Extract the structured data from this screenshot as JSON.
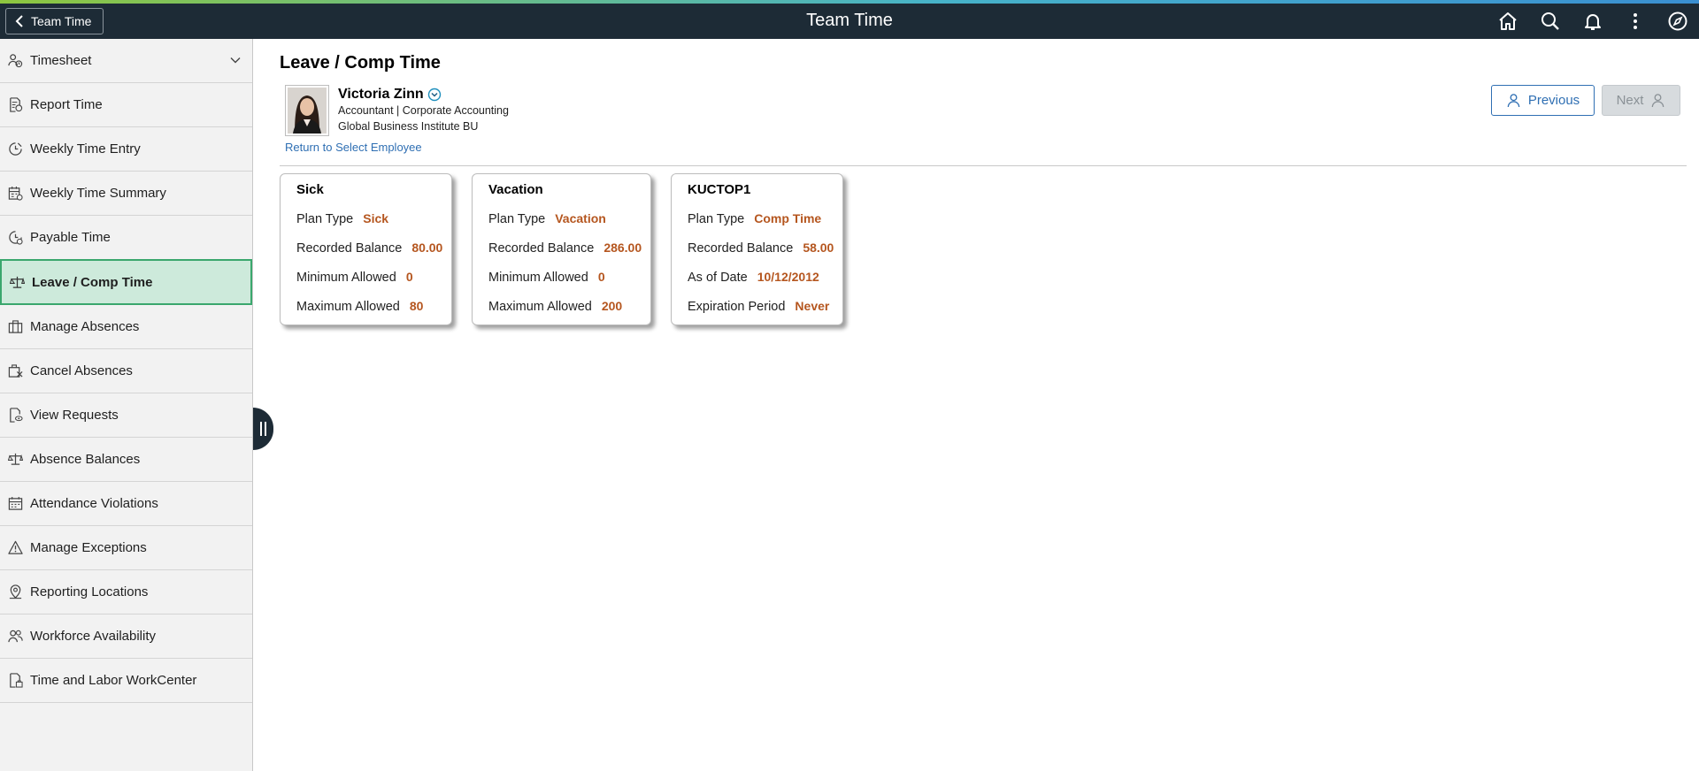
{
  "header": {
    "back_label": "Team Time",
    "title": "Team Time",
    "icons": [
      "home-icon",
      "search-icon",
      "notifications-icon",
      "actions-menu-icon",
      "navbar-icon"
    ]
  },
  "sidebar": {
    "items": [
      {
        "label": "Timesheet",
        "icon": "timesheet-icon",
        "expandable": true
      },
      {
        "label": "Report Time",
        "icon": "report-time-icon"
      },
      {
        "label": "Weekly Time Entry",
        "icon": "weekly-time-entry-icon"
      },
      {
        "label": "Weekly Time Summary",
        "icon": "weekly-summary-icon"
      },
      {
        "label": "Payable Time",
        "icon": "payable-time-icon"
      },
      {
        "label": "Leave / Comp Time",
        "icon": "scale-icon",
        "selected": true
      },
      {
        "label": "Manage Absences",
        "icon": "manage-absences-icon"
      },
      {
        "label": "Cancel Absences",
        "icon": "cancel-absences-icon"
      },
      {
        "label": "View Requests",
        "icon": "view-requests-icon"
      },
      {
        "label": "Absence Balances",
        "icon": "absence-balances-icon"
      },
      {
        "label": "Attendance Violations",
        "icon": "calendar-icon"
      },
      {
        "label": "Manage Exceptions",
        "icon": "warning-icon"
      },
      {
        "label": "Reporting Locations",
        "icon": "location-icon"
      },
      {
        "label": "Workforce Availability",
        "icon": "people-icon"
      },
      {
        "label": "Time and Labor WorkCenter",
        "icon": "workcenter-icon"
      }
    ]
  },
  "page": {
    "title": "Leave / Comp Time",
    "employee": {
      "name": "Victoria Zinn",
      "job": "Accountant | Corporate Accounting",
      "bu": "Global Business Institute BU"
    },
    "return_link": "Return to Select Employee",
    "prev_label": "Previous",
    "next_label": "Next"
  },
  "tiles": [
    {
      "title": "Sick",
      "rows": [
        {
          "label": "Plan Type",
          "value": "Sick"
        },
        {
          "label": "Recorded Balance",
          "value": "80.00"
        },
        {
          "label": "Minimum Allowed",
          "value": "0"
        },
        {
          "label": "Maximum Allowed",
          "value": "80"
        }
      ]
    },
    {
      "title": "Vacation",
      "rows": [
        {
          "label": "Plan Type",
          "value": "Vacation"
        },
        {
          "label": "Recorded Balance",
          "value": "286.00"
        },
        {
          "label": "Minimum Allowed",
          "value": "0"
        },
        {
          "label": "Maximum Allowed",
          "value": "200"
        }
      ]
    },
    {
      "title": "KUCTOP1",
      "rows": [
        {
          "label": "Plan Type",
          "value": "Comp Time"
        },
        {
          "label": "Recorded Balance",
          "value": "58.00"
        },
        {
          "label": "As of Date",
          "value": "10/12/2012"
        },
        {
          "label": "Expiration Period",
          "value": "Never"
        }
      ]
    }
  ],
  "colors": {
    "banner": "#1d2b36",
    "selected_bg": "#cdeadb",
    "selected_border": "#3aa76d",
    "link": "#2f6fb3",
    "value": "#b5561f"
  }
}
